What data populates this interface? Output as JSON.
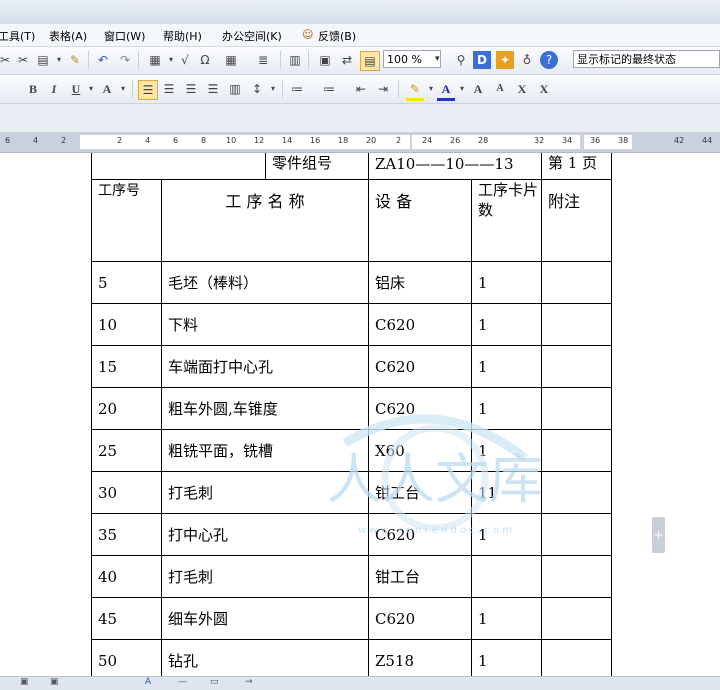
{
  "menu": {
    "items": [
      "工具(T)",
      "表格(A)",
      "窗口(W)",
      "帮助(H)",
      "办公空间(K)",
      "反馈(B)"
    ]
  },
  "toolbar": {
    "zoom": "100 %",
    "status_select": "显示标记的最终状态"
  },
  "ruler": {
    "ticks": [
      "6",
      "4",
      "2",
      "2",
      "4",
      "6",
      "8",
      "10",
      "12",
      "14",
      "16",
      "18",
      "20",
      "2",
      "24",
      "26",
      "28",
      "32",
      "34",
      "36",
      "38",
      "42",
      "44"
    ]
  },
  "table": {
    "top_row": [
      "零件组号",
      "ZA10——10——13",
      "第 1 页"
    ],
    "header": {
      "seq": "工序号",
      "name": "工 序 名 称",
      "equip": "设 备",
      "cards": "工序卡片数",
      "note": "附注"
    },
    "rows": [
      {
        "seq": "5",
        "name": "毛坯（棒料）",
        "equip": "铝床",
        "cards": "1",
        "note": ""
      },
      {
        "seq": "10",
        "name": "下料",
        "equip": "C620",
        "cards": "1",
        "note": ""
      },
      {
        "seq": "15",
        "name": "车端面打中心孔",
        "equip": "C620",
        "cards": "1",
        "note": ""
      },
      {
        "seq": "20",
        "name": "粗车外圆,车锥度",
        "equip": "C620",
        "cards": "1",
        "note": ""
      },
      {
        "seq": "25",
        "name": "粗铣平面，铣槽",
        "equip": "X60",
        "cards": "1",
        "note": ""
      },
      {
        "seq": "30",
        "name": "打毛刺",
        "equip": "钳工台",
        "cards": "11",
        "note": ""
      },
      {
        "seq": "35",
        "name": "打中心孔",
        "equip": "C620",
        "cards": "1",
        "note": ""
      },
      {
        "seq": "40",
        "name": "打毛刺",
        "equip": "钳工台",
        "cards": "",
        "note": ""
      },
      {
        "seq": "45",
        "name": "细车外圆",
        "equip": "C620",
        "cards": "1",
        "note": ""
      },
      {
        "seq": "50",
        "name": "钻孔",
        "equip": "Z518",
        "cards": "1",
        "note": ""
      }
    ]
  },
  "watermark": {
    "text": "人人文库",
    "url": "w w w . r e n r e n d o c . c o m"
  }
}
